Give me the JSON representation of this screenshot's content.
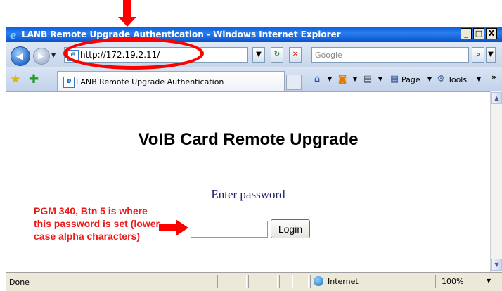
{
  "window": {
    "title": "LANB Remote Upgrade Authentication - Windows Internet Explorer",
    "minimize": "_",
    "maximize": "□",
    "close": "X"
  },
  "navbar": {
    "url": "http://172.19.2.11/",
    "search_placeholder": "Google"
  },
  "tabbar": {
    "tab_title": "LANB Remote Upgrade Authentication",
    "page_label": "Page",
    "tools_label": "Tools",
    "overflow": "»"
  },
  "content": {
    "heading": "VoIB Card Remote Upgrade",
    "prompt": "Enter password",
    "password_value": "",
    "login_label": "Login"
  },
  "statusbar": {
    "status_text": "Done",
    "zone_text": "Internet",
    "zoom_text": "100%"
  },
  "annotation": {
    "note": "PGM 340, Btn 5 is where this password is set (lower case alpha characters)",
    "color": "#ff0000"
  }
}
